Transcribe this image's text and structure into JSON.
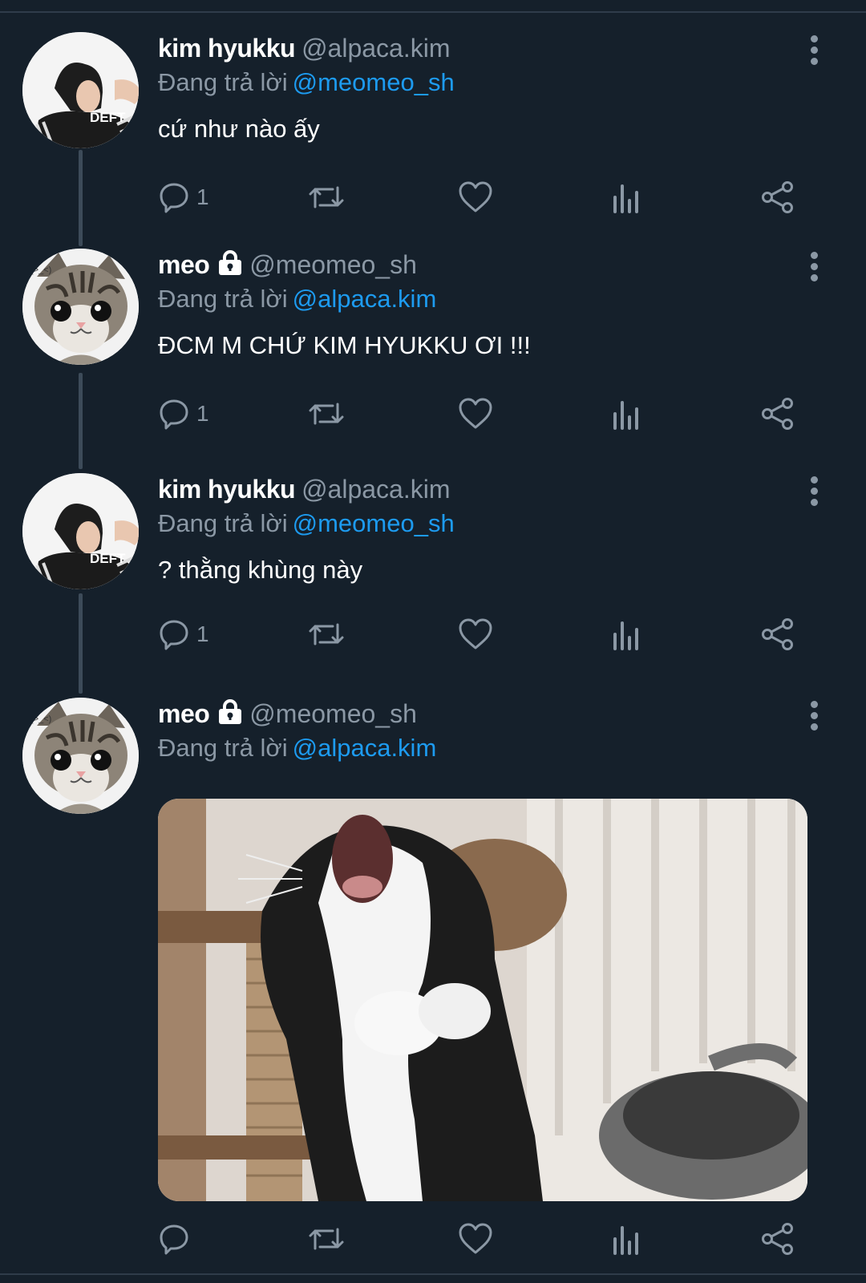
{
  "tweets": [
    {
      "name": "kim hyukku",
      "handle": "@alpaca.kim",
      "replying_label": "Đang trả lời",
      "replying_to": "@meomeo_sh",
      "text": "cứ như nào ấy",
      "reply_count": "1",
      "locked": false,
      "avatar": "deft-avatar"
    },
    {
      "name": "meo",
      "handle": "@meomeo_sh",
      "replying_label": "Đang trả lời",
      "replying_to": "@alpaca.kim",
      "text": "ĐCM M CHỨ KIM HYUKKU ƠI !!!",
      "reply_count": "1",
      "locked": true,
      "avatar": "kitten-avatar"
    },
    {
      "name": "kim hyukku",
      "handle": "@alpaca.kim",
      "replying_label": "Đang trả lời",
      "replying_to": "@meomeo_sh",
      "text": "? thằng khùng này",
      "reply_count": "1",
      "locked": false,
      "avatar": "deft-avatar"
    },
    {
      "name": "meo",
      "handle": "@meomeo_sh",
      "replying_label": "Đang trả lời",
      "replying_to": "@alpaca.kim",
      "text": "",
      "reply_count": "",
      "locked": true,
      "avatar": "kitten-avatar",
      "media": "screaming-cat-photo"
    }
  ],
  "avatar_labels": {
    "deft_jersey": "DEFT",
    "kitten_tag": "(>_<)"
  },
  "colors": {
    "background": "#15202b",
    "secondary_text": "#8b98a5",
    "link": "#1d9bf0",
    "thread_line": "#3d4b59"
  }
}
